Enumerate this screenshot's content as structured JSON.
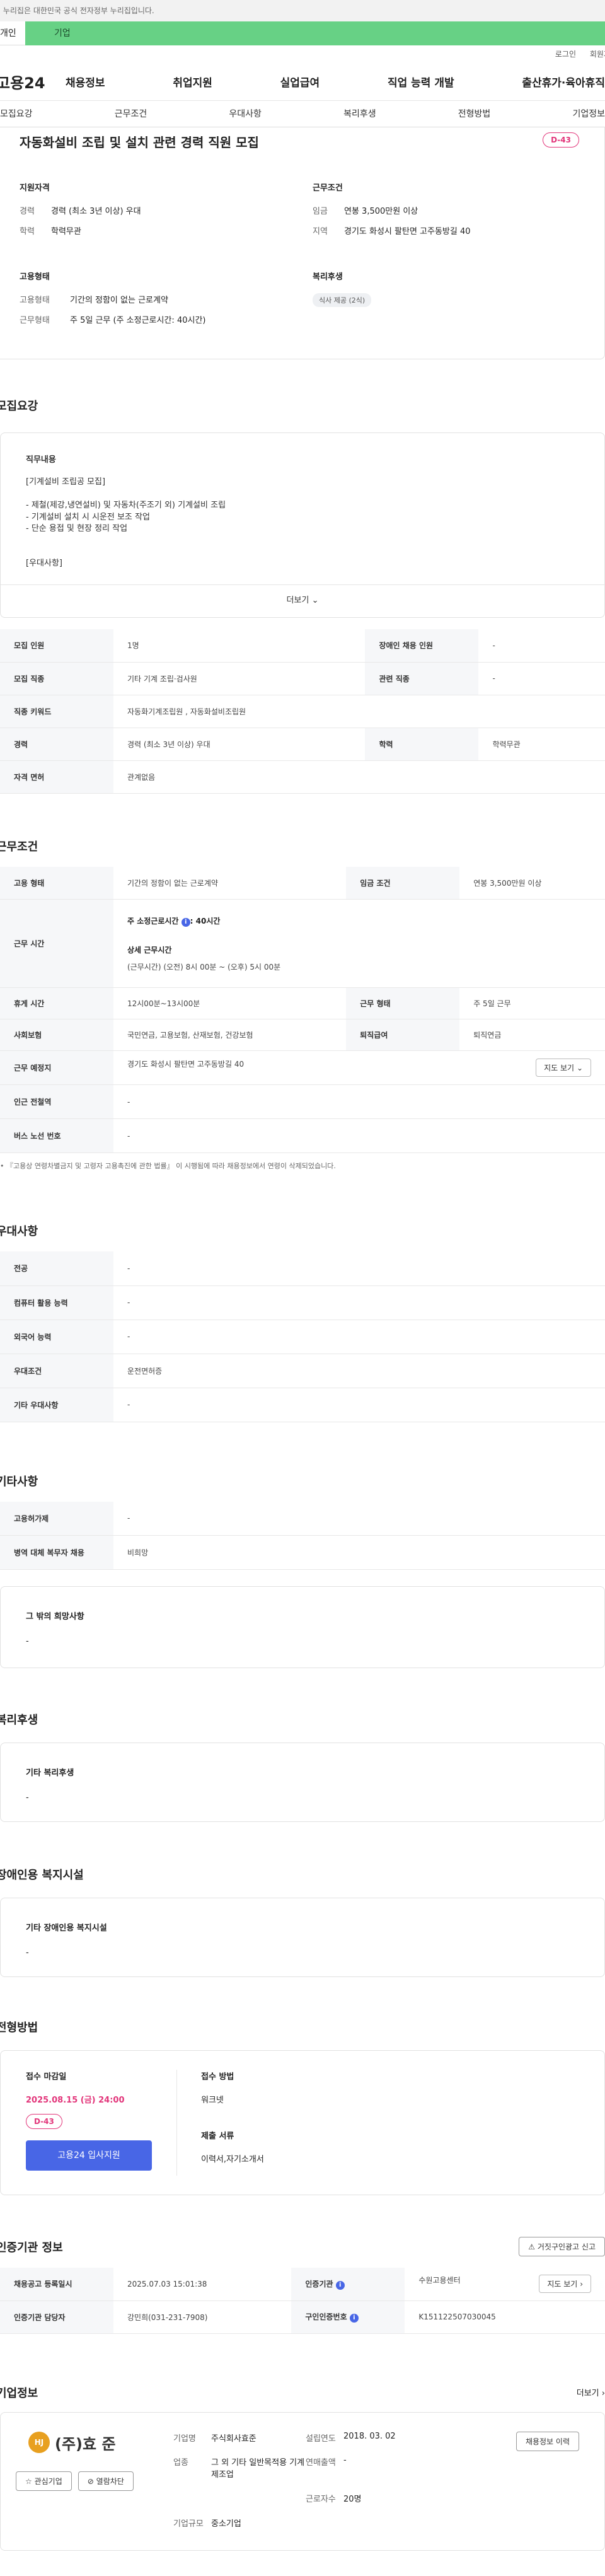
{
  "gov_banner": "이 누리집은 대한민국 공식 전자정부 누리집입니다.",
  "tabs": {
    "person": "개인",
    "company": "기업"
  },
  "topbar": {
    "login": "로그인",
    "join": "회원가입"
  },
  "logo": "고용24",
  "gnb": [
    "채용정보",
    "취업지원",
    "실업급여",
    "직업 능력 개발",
    "출산휴가·육아휴직"
  ],
  "subnav": [
    "모집요강",
    "근무조건",
    "우대사항",
    "복리후생",
    "전형방법",
    "기업정보"
  ],
  "summary": {
    "title": "자동화설비 조립 및 설치 관련 경력 직원 모집",
    "dday": "D-43",
    "qual_title": "지원자격",
    "career_k": "경력",
    "career_v": "경력 (최소 3년 이상) 우대",
    "edu_k": "학력",
    "edu_v": "학력무관",
    "cond_title": "근무조건",
    "wage_k": "임금",
    "wage_v": "연봉 3,500만원 이상",
    "area_k": "지역",
    "area_v": "경기도 화성시 팔탄면 고주동방길 40",
    "emp_title": "고용형태",
    "emptype_k": "고용형태",
    "emptype_v": "기간의 정함이 없는 근로계약",
    "worktype_k": "근무형태",
    "worktype_v": "주 5일 근무 (주 소정근로시간: 40시간)",
    "welfare_title": "복리후생",
    "welfare_chip": "식사 제공 (2식)"
  },
  "recruit": {
    "section": "모집요강",
    "duty_title": "직무내용",
    "duty_lines": [
      "[기계설비 조립공 모집]",
      "",
      "- 제철(제강,냉연설비) 및 자동차(주조기 외) 기계설비 조립",
      "- 기계설비 설치 시 시운전 보조 작업",
      "- 단순 용접 및 현장 정리 작업",
      "",
      "",
      "[우대사항]"
    ],
    "more": "더보기",
    "rows": [
      {
        "k1": "모집 인원",
        "v1": "1명",
        "k2": "장애인 채용 인원",
        "v2": "-"
      },
      {
        "k1": "모집 직종",
        "v1": "기타 기계 조립·검사원",
        "k2": "관련 직종",
        "v2": "-"
      },
      {
        "k1": "직종 키워드",
        "v1": "자동화기계조립원 , 자동화설비조립원"
      },
      {
        "k1": "경력",
        "v1": "경력 (최소 3년 이상) 우대",
        "k2": "학력",
        "v2": "학력무관"
      },
      {
        "k1": "자격 면허",
        "v1": "관계없음"
      }
    ]
  },
  "work": {
    "section": "근무조건",
    "emp_k": "고용 형태",
    "emp_v": "기간의 정함이 없는 근로계약",
    "wage_k": "임금 조건",
    "wage_v": "연봉 3,500만원 이상",
    "time_k": "근무 시간",
    "time_main": "주 소정근로시간",
    "time_main_v": ": 40시간",
    "time_detail_h": "상세 근무시간",
    "time_detail": "(근무시간) (오전) 8시 00분 ~ (오후) 5시 00분",
    "rest_k": "휴게 시간",
    "rest_v": "12시00분~13시00분",
    "form_k": "근무 형태",
    "form_v": "주 5일 근무",
    "ins_k": "사회보험",
    "ins_v": "국민연금, 고용보험, 산재보험, 건강보험",
    "ret_k": "퇴직급여",
    "ret_v": "퇴직연금",
    "place_k": "근무 예정지",
    "place_v": "경기도 화성시 팔탄면 고주동방길 40",
    "map": "지도 보기",
    "subway_k": "인근 전철역",
    "subway_v": "-",
    "bus_k": "버스 노선 번호",
    "bus_v": "-",
    "note": "• 『고용상 연령차별금지 및 고령자 고용촉진에 관한 법률』 이 시행됨에 따라 채용정보에서 연령이 삭제되었습니다."
  },
  "pref": {
    "section": "우대사항",
    "rows": [
      {
        "k": "전공",
        "v": "-"
      },
      {
        "k": "컴퓨터 활용 능력",
        "v": "-"
      },
      {
        "k": "외국어 능력",
        "v": "-"
      },
      {
        "k": "우대조건",
        "v": "운전면허증"
      },
      {
        "k": "기타 우대사항",
        "v": "-"
      }
    ]
  },
  "etc": {
    "section": "기타사항",
    "rows": [
      {
        "k": "고용허가제",
        "v": "-"
      },
      {
        "k": "병역 대체 복무자 채용",
        "v": "비희망"
      }
    ],
    "hope_title": "그 밖의 희망사항",
    "hope_v": "-"
  },
  "welfare": {
    "section": "복리후생",
    "title": "기타 복리후생",
    "v": "-"
  },
  "disabled": {
    "section": "장애인용 복지시설",
    "title": "기타 장애인용 복지시설",
    "v": "-"
  },
  "process": {
    "section": "전형방법",
    "deadline_h": "접수 마감일",
    "deadline": "2025.08.15 (금) 24:00",
    "dday": "D-43",
    "apply": "고용24 입사지원",
    "method_h": "접수 방법",
    "method": "워크넷",
    "docs_h": "제출 서류",
    "docs": "이력서,자기소개서"
  },
  "cert": {
    "section": "인증기관 정보",
    "report": "거짓구인광고 신고",
    "reg_k": "채용공고 등록일시",
    "reg_v": "2025.07.03 15:01:38",
    "org_k": "인증기관",
    "org_v": "수원고용센터",
    "map": "지도 보기",
    "mgr_k": "인증기관 담당자",
    "mgr_v": "강민희(031-231-7908)",
    "no_k": "구인인증번호",
    "no_v": "K151122507030045"
  },
  "company": {
    "section": "기업정보",
    "more": "더보기",
    "name": "(주)효 준",
    "interest": "관심기업",
    "block": "열람차단",
    "name_k": "기업명",
    "name_v": "주식회사효준",
    "est_k": "설립연도",
    "est_v": "2018. 03. 02",
    "ind_k": "업종",
    "ind_v": "그 외 기타 일반목적용 기계 제조업",
    "sales_k": "연매출액",
    "sales_v": "-",
    "emp_k": "근로자수",
    "emp_v": "20명",
    "size_k": "기업규모",
    "size_v": "중소기업",
    "jobs_btn": "채용정보 이력"
  }
}
